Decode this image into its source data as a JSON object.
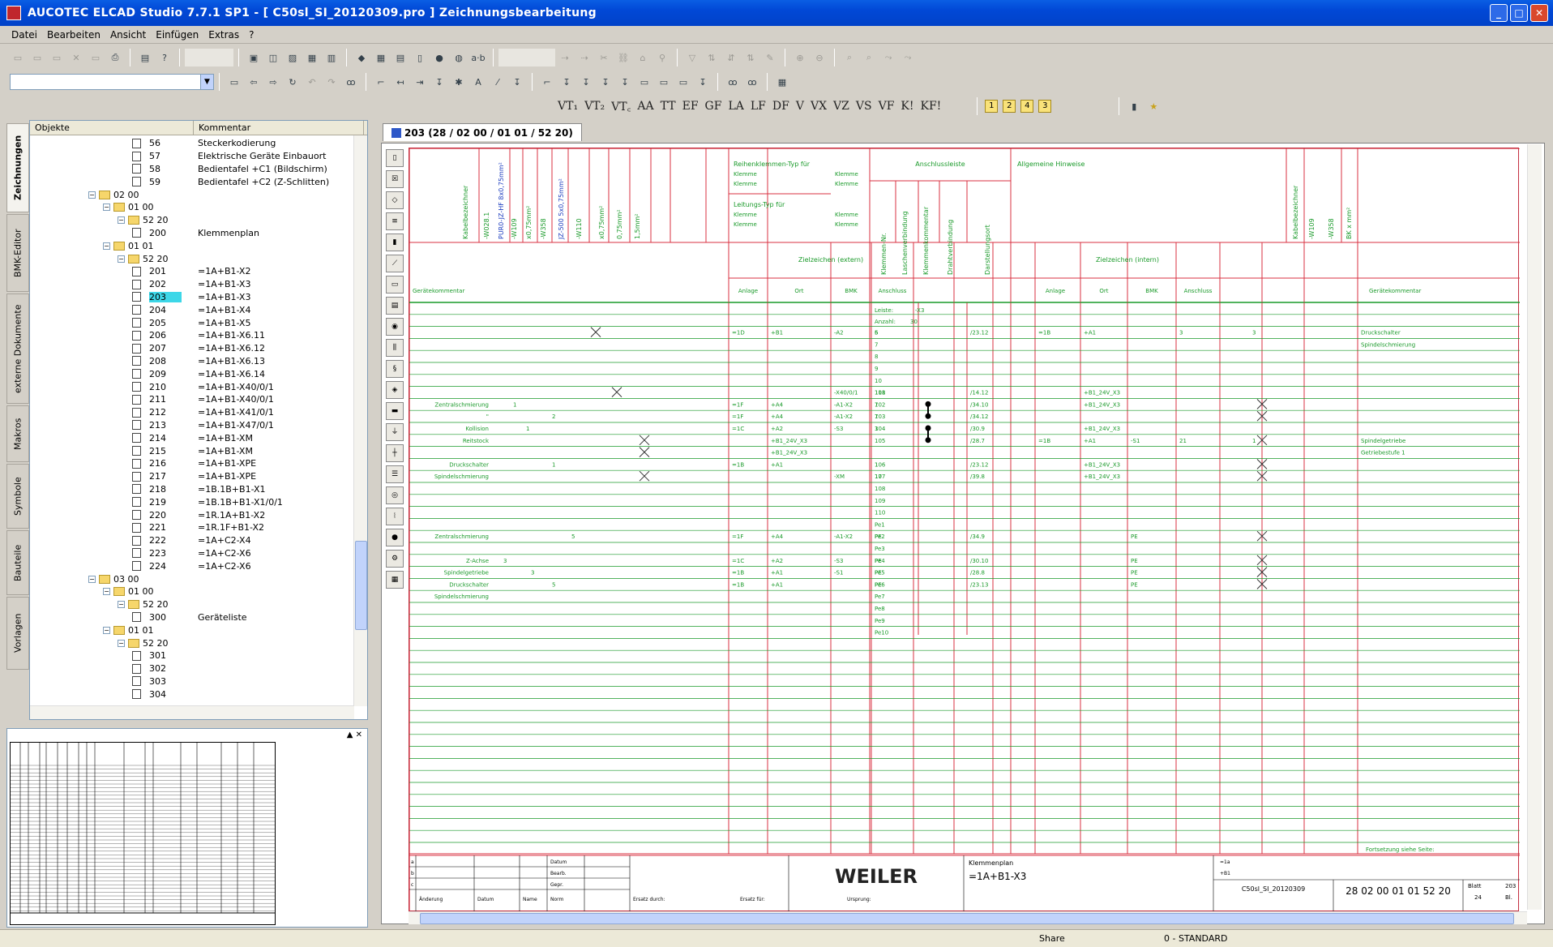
{
  "window": {
    "title": "AUCOTEC    ELCAD Studio 7.7.1 SP1 -  [ C50sl_SI_20120309.pro ]  Zeichnungsbearbeitung",
    "minimize": "_",
    "maximize": "□",
    "close": "✕"
  },
  "menu": [
    "Datei",
    "Bearbeiten",
    "Ansicht",
    "Einfügen",
    "Extras",
    "?"
  ],
  "toolbar3": {
    "symbols": [
      "VT₁",
      "VT₂",
      "VT꜀",
      "AA",
      "TT",
      "EF",
      "GF",
      "LA",
      "LF",
      "DF",
      "V",
      "VX",
      "VZ",
      "VS",
      "VF",
      "K!",
      "KF!"
    ],
    "pages": [
      "1",
      "2",
      "4",
      "3"
    ]
  },
  "side_tabs": [
    "Zeichnungen",
    "BMK-Editor",
    "externe Dokumente",
    "Makros",
    "Symbole",
    "Bauteile",
    "Vorlagen"
  ],
  "tree": {
    "headers": {
      "col1": "Objekte",
      "col2": "Kommentar"
    },
    "rows": [
      {
        "lvl": 6,
        "type": "doc",
        "num": "56",
        "comment": "Steckerkodierung"
      },
      {
        "lvl": 6,
        "type": "doc",
        "num": "57",
        "comment": "Elektrische Geräte Einbauort"
      },
      {
        "lvl": 6,
        "type": "doc",
        "num": "58",
        "comment": "Bedientafel +C1 (Bildschirm)"
      },
      {
        "lvl": 6,
        "type": "doc",
        "num": "59",
        "comment": "Bedientafel +C2 (Z-Schlitten)"
      },
      {
        "lvl": 3,
        "type": "folder",
        "num": "02 00",
        "comment": ""
      },
      {
        "lvl": 4,
        "type": "folder",
        "num": "01 00",
        "comment": ""
      },
      {
        "lvl": 5,
        "type": "folder",
        "num": "52 20",
        "comment": ""
      },
      {
        "lvl": 6,
        "type": "doc",
        "num": "200",
        "comment": "Klemmenplan"
      },
      {
        "lvl": 4,
        "type": "folder",
        "num": "01 01",
        "comment": ""
      },
      {
        "lvl": 5,
        "type": "folder",
        "num": "52 20",
        "comment": ""
      },
      {
        "lvl": 6,
        "type": "doc",
        "num": "201",
        "comment": "=1A+B1-X2"
      },
      {
        "lvl": 6,
        "type": "doc",
        "num": "202",
        "comment": "=1A+B1-X3"
      },
      {
        "lvl": 6,
        "type": "doc",
        "num": "203",
        "comment": "=1A+B1-X3",
        "selected": true
      },
      {
        "lvl": 6,
        "type": "doc",
        "num": "204",
        "comment": "=1A+B1-X4"
      },
      {
        "lvl": 6,
        "type": "doc",
        "num": "205",
        "comment": "=1A+B1-X5"
      },
      {
        "lvl": 6,
        "type": "doc",
        "num": "206",
        "comment": "=1A+B1-X6.11"
      },
      {
        "lvl": 6,
        "type": "doc",
        "num": "207",
        "comment": "=1A+B1-X6.12"
      },
      {
        "lvl": 6,
        "type": "doc",
        "num": "208",
        "comment": "=1A+B1-X6.13"
      },
      {
        "lvl": 6,
        "type": "doc",
        "num": "209",
        "comment": "=1A+B1-X6.14"
      },
      {
        "lvl": 6,
        "type": "doc",
        "num": "210",
        "comment": "=1A+B1-X40/0/1"
      },
      {
        "lvl": 6,
        "type": "doc",
        "num": "211",
        "comment": "=1A+B1-X40/0/1"
      },
      {
        "lvl": 6,
        "type": "doc",
        "num": "212",
        "comment": "=1A+B1-X41/0/1"
      },
      {
        "lvl": 6,
        "type": "doc",
        "num": "213",
        "comment": "=1A+B1-X47/0/1"
      },
      {
        "lvl": 6,
        "type": "doc",
        "num": "214",
        "comment": "=1A+B1-XM"
      },
      {
        "lvl": 6,
        "type": "doc",
        "num": "215",
        "comment": "=1A+B1-XM"
      },
      {
        "lvl": 6,
        "type": "doc",
        "num": "216",
        "comment": "=1A+B1-XPE"
      },
      {
        "lvl": 6,
        "type": "doc",
        "num": "217",
        "comment": "=1A+B1-XPE"
      },
      {
        "lvl": 6,
        "type": "doc",
        "num": "218",
        "comment": "=1B.1B+B1-X1"
      },
      {
        "lvl": 6,
        "type": "doc",
        "num": "219",
        "comment": "=1B.1B+B1-X1/0/1"
      },
      {
        "lvl": 6,
        "type": "doc",
        "num": "220",
        "comment": "=1R.1A+B1-X2"
      },
      {
        "lvl": 6,
        "type": "doc",
        "num": "221",
        "comment": "=1R.1F+B1-X2"
      },
      {
        "lvl": 6,
        "type": "doc",
        "num": "222",
        "comment": "=1A+C2-X4"
      },
      {
        "lvl": 6,
        "type": "doc",
        "num": "223",
        "comment": "=1A+C2-X6"
      },
      {
        "lvl": 6,
        "type": "doc",
        "num": "224",
        "comment": "=1A+C2-X6"
      },
      {
        "lvl": 3,
        "type": "folder",
        "num": "03 00",
        "comment": ""
      },
      {
        "lvl": 4,
        "type": "folder",
        "num": "01 00",
        "comment": ""
      },
      {
        "lvl": 5,
        "type": "folder",
        "num": "52 20",
        "comment": ""
      },
      {
        "lvl": 6,
        "type": "doc",
        "num": "300",
        "comment": "Geräteliste"
      },
      {
        "lvl": 4,
        "type": "folder",
        "num": "01 01",
        "comment": ""
      },
      {
        "lvl": 5,
        "type": "folder",
        "num": "52 20",
        "comment": ""
      },
      {
        "lvl": 6,
        "type": "doc",
        "num": "301",
        "comment": ""
      },
      {
        "lvl": 6,
        "type": "doc",
        "num": "302",
        "comment": ""
      },
      {
        "lvl": 6,
        "type": "doc",
        "num": "303",
        "comment": ""
      },
      {
        "lvl": 6,
        "type": "doc",
        "num": "304",
        "comment": ""
      }
    ]
  },
  "doc_tab": "203 (28 / 02 00 / 01 01 / 52 20)",
  "sheet": {
    "left_vertical_headers": [
      "Kabelbezeichner",
      "-W028.1",
      "PUR0-JZ-HF 8x0,75mm²",
      "-W109",
      "x0,75mm²",
      "-W358",
      "JZ-500 5x0,75mm²",
      "-W110",
      "x0,75mm²",
      "0,75mm²",
      "1,5mm²"
    ],
    "right_vertical_headers": [
      "Kabelbezeichner",
      "-W109",
      "-W358",
      "BK x mm²"
    ],
    "terminal_headers": [
      "Klemmen-Nr.",
      "Laschenverbindung",
      "Klemmenkommentar",
      "Drahtverbindung",
      "Darstellungsort"
    ],
    "reihen": {
      "title": "Reihenklemmen-Typ für",
      "l1": "Klemme",
      "l2": "Klemme",
      "title2": "Leitungs-Typ für"
    },
    "anschluss_title": "Anschlussleiste",
    "hinweise_title": "Allgemeine Hinweise",
    "ziel_extern": "Zielzeichen (extern)",
    "ziel_intern": "Zielzeichen (intern)",
    "ziel_cols": [
      "Anlage",
      "Ort",
      "BMK",
      "Anschluss"
    ],
    "geraetekommentar": "Gerätekommentar",
    "leiste_label": "Leiste:",
    "leiste_val": "-X3",
    "anzahl_label": "Anzahl:",
    "anzahl_val": "30",
    "terminals": [
      "6",
      "7",
      "8",
      "9",
      "10",
      "101",
      "102",
      "103",
      "104",
      "105",
      "",
      "106",
      "107",
      "108",
      "109",
      "110",
      "Pe1",
      "Pe2",
      "Pe3",
      "Pe4",
      "Pe5",
      "Pe6",
      "Pe7",
      "Pe8",
      "Pe9",
      "Pe10"
    ],
    "ext_rows": [
      {
        "r": 0,
        "anl": "=1D",
        "ort": "+B1",
        "bmk": "-A2",
        "an": "5",
        "dar": "/23.12"
      },
      {
        "r": 5,
        "anl": "",
        "ort": "",
        "bmk": "-X40/0/1",
        "an": "118",
        "dar": "/14.12"
      },
      {
        "r": 6,
        "anl": "=1F",
        "ort": "+A4",
        "bmk": "-A1-X2",
        "an": "7",
        "dar": "/34.10"
      },
      {
        "r": 7,
        "anl": "=1F",
        "ort": "+A4",
        "bmk": "-A1-X2",
        "an": "7",
        "dar": "/34.12"
      },
      {
        "r": 8,
        "anl": "=1C",
        "ort": "+A2",
        "bmk": "-S3",
        "an": "3",
        "dar": "/30.9"
      },
      {
        "r": 9,
        "anl": "",
        "ort": "+B1_24V_X3",
        "bmk": "",
        "an": "",
        "dar": "/28.7"
      },
      {
        "r": 10,
        "anl": "",
        "ort": "+B1_24V_X3",
        "bmk": "",
        "an": "",
        "dar": ""
      },
      {
        "r": 11,
        "anl": "=1B",
        "ort": "+A1",
        "bmk": "",
        "an": "1",
        "dar": "/23.12"
      },
      {
        "r": 12,
        "anl": "",
        "ort": "",
        "bmk": "-XM",
        "an": "17",
        "dar": "/39.8"
      },
      {
        "r": 17,
        "anl": "=1F",
        "ort": "+A4",
        "bmk": "-A1-X2",
        "an": "PE",
        "dar": "/34.9"
      },
      {
        "r": 19,
        "anl": "=1C",
        "ort": "+A2",
        "bmk": "-S3",
        "an": "PE",
        "dar": "/30.10"
      },
      {
        "r": 20,
        "anl": "=1B",
        "ort": "+A1",
        "bmk": "-S1",
        "an": "PE",
        "dar": "/28.8"
      },
      {
        "r": 21,
        "anl": "=1B",
        "ort": "+A1",
        "bmk": "",
        "an": "PE",
        "dar": "/23.13"
      }
    ],
    "int_rows": [
      {
        "r": 0,
        "anl": "=1B",
        "ort": "+A1",
        "bmk": "",
        "an": "3",
        "x": "3",
        "k": "Druckschalter"
      },
      {
        "r": 1,
        "anl": "",
        "ort": "",
        "bmk": "",
        "an": "",
        "x": "",
        "k": "Spindelschmierung"
      },
      {
        "r": 5,
        "anl": "",
        "ort": "+B1_24V_X3",
        "bmk": "",
        "an": "",
        "x": "",
        "k": ""
      },
      {
        "r": 6,
        "anl": "",
        "ort": "+B1_24V_X3",
        "bmk": "",
        "an": "",
        "x": "",
        "k": ""
      },
      {
        "r": 8,
        "anl": "",
        "ort": "+B1_24V_X3",
        "bmk": "",
        "an": "",
        "x": "",
        "k": ""
      },
      {
        "r": 9,
        "anl": "=1B",
        "ort": "+A1",
        "bmk": "-S1",
        "an": "21",
        "x": "1",
        "k": "Spindelgetriebe"
      },
      {
        "r": 10,
        "anl": "",
        "ort": "",
        "bmk": "",
        "an": "",
        "x": "",
        "k": "Getriebestufe 1"
      },
      {
        "r": 11,
        "anl": "",
        "ort": "+B1_24V_X3",
        "bmk": "",
        "an": "",
        "x": "",
        "k": ""
      },
      {
        "r": 12,
        "anl": "",
        "ort": "+B1_24V_X3",
        "bmk": "",
        "an": "",
        "x": "",
        "k": ""
      },
      {
        "r": 17,
        "anl": "",
        "ort": "",
        "bmk": "PE",
        "an": "",
        "x": "",
        "k": ""
      },
      {
        "r": 19,
        "anl": "",
        "ort": "",
        "bmk": "PE",
        "an": "",
        "x": "",
        "k": ""
      },
      {
        "r": 20,
        "anl": "",
        "ort": "",
        "bmk": "PE",
        "an": "",
        "x": "",
        "k": ""
      },
      {
        "r": 21,
        "anl": "",
        "ort": "",
        "bmk": "PE",
        "an": "",
        "x": "",
        "k": ""
      }
    ],
    "left_comments": [
      {
        "r": 6,
        "t": "Zentralschmierung",
        "n": "1"
      },
      {
        "r": 7,
        "t": "\"",
        "n": "2"
      },
      {
        "r": 8,
        "t": "Kollision",
        "n": "1"
      },
      {
        "r": 9,
        "t": "Reitstock",
        "n": ""
      },
      {
        "r": 11,
        "t": "Druckschalter",
        "n": "1"
      },
      {
        "r": 12,
        "t": "Spindelschmierung",
        "n": ""
      },
      {
        "r": 17,
        "t": "Zentralschmierung",
        "n": "5"
      },
      {
        "r": 19,
        "t": "Z-Achse",
        "n": "3"
      },
      {
        "r": 20,
        "t": "Spindelgetriebe",
        "n": "3"
      },
      {
        "r": 21,
        "t": "Druckschalter",
        "n": "5"
      },
      {
        "r": 22,
        "t": "Spindelschmierung",
        "n": ""
      }
    ],
    "fortsetzung": "Fortsetzung siehe Seite:",
    "titleblock": {
      "company": "WEILER",
      "doc_type": "Klemmenplan",
      "ref": "=1A+B1-X3",
      "project": "C50sl_SI_20120309",
      "code": "28 02 00 01 01 52 20",
      "blatt_label": "Blatt",
      "blatt": "203",
      "bl_count": "24",
      "bl_label": "Bl.",
      "lbl_datum": "Datum",
      "lbl_bearb": "Bearb.",
      "lbl_gepr": "Gepr.",
      "lbl_name": "Name",
      "lbl_norm": "Norm",
      "lbl_aenderung": "Änderung",
      "lbl_ersatz": "Ersatz durch:",
      "lbl_ersatzfuer": "Ersatz für:",
      "lbl_ursprung": "Ursprung:",
      "lbl_anlage": "=1a",
      "lbl_ort": "+B1",
      "rev": [
        "a",
        "b",
        "c"
      ]
    }
  },
  "status": {
    "share": "Share",
    "standard": "0 - STANDARD"
  },
  "colors": {
    "red": "#d83040",
    "green": "#1a9a2a",
    "title_blue": "#0148d6"
  }
}
